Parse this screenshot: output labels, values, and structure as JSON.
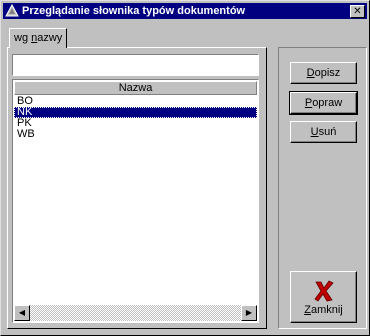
{
  "window": {
    "title": "Przeglądanie słownika typów dokumentów",
    "close_glyph": "✕"
  },
  "tab": {
    "label": "wg nazwy"
  },
  "search": {
    "value": ""
  },
  "list": {
    "column_header": "Nazwa",
    "rows": [
      "BO",
      "NK",
      "PK",
      "WB"
    ],
    "selected_index": 1
  },
  "scrollbar": {
    "left_arrow": "◀",
    "right_arrow": "▶"
  },
  "buttons": {
    "add": "Dopisz",
    "edit": "Popraw",
    "delete": "Usuń",
    "close": "Zamknij"
  },
  "colors": {
    "titlebar": "#000080",
    "selection": "#000080",
    "close_x": "#c00000"
  }
}
